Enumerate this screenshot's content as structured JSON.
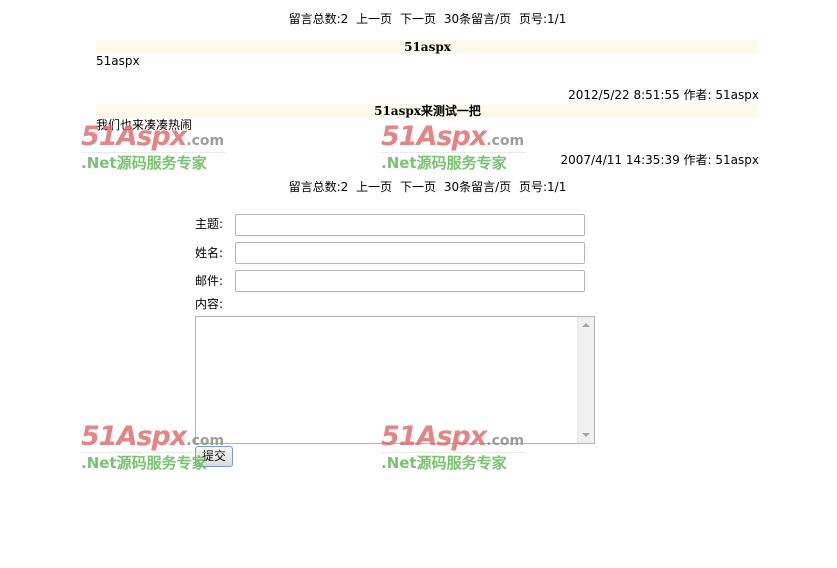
{
  "pager": {
    "total": "留言总数:2",
    "prev": "上一页",
    "next": "下一页",
    "per_page": "30条留言/页",
    "page": "页号:1/1"
  },
  "posts": [
    {
      "title": "51aspx",
      "body": "51aspx",
      "meta": "2012/5/22 8:51:55 作者: 51aspx"
    },
    {
      "title": "51aspx来测试一把",
      "body": "我们也来凑凑热闹",
      "meta": "2007/4/11 14:35:39 作者: 51aspx"
    }
  ],
  "form": {
    "subject_label": "主题:",
    "name_label": "姓名:",
    "email_label": "邮件:",
    "content_label": "内容:",
    "subject_value": "",
    "name_value": "",
    "email_value": "",
    "content_value": "",
    "submit_label": "提交"
  },
  "watermark": {
    "logo_text": "51Aspx",
    "logo_suffix": ".com",
    "tagline": ".Net源码服务专家"
  },
  "colors": {
    "title_bar_bg": "#fcfaec",
    "watermark_logo": "#e07070",
    "watermark_tagline": "#6dbb63"
  }
}
